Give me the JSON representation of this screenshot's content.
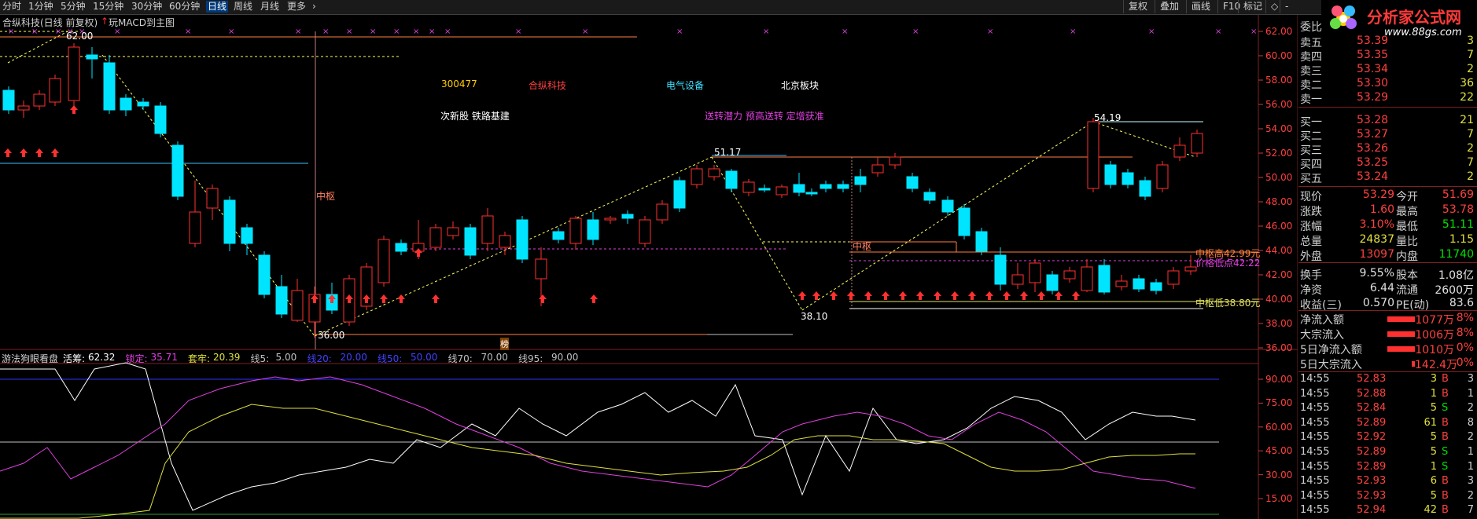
{
  "toolbar": {
    "tabs": [
      "分时",
      "1分钟",
      "5分钟",
      "15分钟",
      "30分钟",
      "60分钟",
      "日线",
      "周线",
      "月线",
      "更多",
      "›"
    ],
    "active_tab": "日线",
    "right_buttons": [
      "复权",
      "叠加",
      "画线",
      "F10",
      "标记",
      "◇",
      "-"
    ]
  },
  "logo": {
    "brand": "分析家公式网",
    "url": "www.88gs.com"
  },
  "chart_header": {
    "stock_title": "合纵科技(日线 前复权)",
    "macd_label": "玩MACD到主图"
  },
  "annotations": {
    "code": "300477",
    "name": "合纵科技",
    "industry": "电气设备",
    "region": "北京板块",
    "concepts": "次新股 铁路基建",
    "signals": "送转潜力 预高送转 定增获准",
    "zhongshu1": "中枢",
    "zhongshu2": "中枢",
    "high_label": "中枢高42.99元",
    "price_label": "价格低点42.22",
    "low_label": "中枢低38.80元",
    "p_top": "62.00",
    "p_5412": "54.19",
    "p_5117": "51.17",
    "p_3810": "38.10",
    "p_3600": "36.00",
    "bang": "榜"
  },
  "price_axis": [
    "62.00",
    "60.00",
    "58.00",
    "56.00",
    "54.00",
    "52.00",
    "50.00",
    "48.00",
    "46.00",
    "44.00",
    "42.00",
    "40.00",
    "38.00",
    "36.00"
  ],
  "indicator": {
    "name": "游法狗眼看盘",
    "items": [
      {
        "label": "活筹:",
        "value": "62.32",
        "color": "#ffffff"
      },
      {
        "label": "锁定:",
        "value": "35.71",
        "color": "#e040e0"
      },
      {
        "label": "套牢:",
        "value": "20.39",
        "color": "#e0e040"
      },
      {
        "label": "线5:",
        "value": "5.00",
        "color": "#c0c0c0"
      },
      {
        "label": "线20:",
        "value": "20.00",
        "color": "#4040ff"
      },
      {
        "label": "线50:",
        "value": "50.00",
        "color": "#4040ff"
      },
      {
        "label": "线70:",
        "value": "70.00",
        "color": "#c0c0c0"
      },
      {
        "label": "线95:",
        "value": "90.00",
        "color": "#c0c0c0"
      }
    ],
    "axis": [
      "90.00",
      "75.00",
      "60.00",
      "45.00",
      "30.00",
      "15.00"
    ]
  },
  "orderbook": {
    "header": "委比",
    "sell": [
      {
        "label": "卖五",
        "price": "53.39",
        "vol": "3"
      },
      {
        "label": "卖四",
        "price": "53.35",
        "vol": "7"
      },
      {
        "label": "卖三",
        "price": "53.34",
        "vol": "2"
      },
      {
        "label": "卖二",
        "price": "53.30",
        "vol": "36"
      },
      {
        "label": "卖一",
        "price": "53.29",
        "vol": "22"
      }
    ],
    "buy": [
      {
        "label": "买一",
        "price": "53.28",
        "vol": "21"
      },
      {
        "label": "买二",
        "price": "53.27",
        "vol": "7"
      },
      {
        "label": "买三",
        "price": "53.26",
        "vol": "2"
      },
      {
        "label": "买四",
        "price": "53.25",
        "vol": "7"
      },
      {
        "label": "买五",
        "price": "53.24",
        "vol": "2"
      }
    ]
  },
  "stats": [
    {
      "l1": "现价",
      "v1": "53.29",
      "c1": "#ff4040",
      "l2": "今开",
      "v2": "51.69",
      "c2": "#ff4040"
    },
    {
      "l1": "涨跌",
      "v1": "1.60",
      "c1": "#ff4040",
      "l2": "最高",
      "v2": "53.78",
      "c2": "#ff4040"
    },
    {
      "l1": "涨幅",
      "v1": "3.10%",
      "c1": "#ff4040",
      "l2": "最低",
      "v2": "51.11",
      "c2": "#00e000"
    },
    {
      "l1": "总量",
      "v1": "24837",
      "c1": "#e0e040",
      "l2": "量比",
      "v2": "1.15",
      "c2": "#e0e040"
    },
    {
      "l1": "外盘",
      "v1": "13097",
      "c1": "#ff4040",
      "l2": "内盘",
      "v2": "11740",
      "c2": "#00e000"
    },
    {
      "l1": "换手",
      "v1": "9.55%",
      "c1": "#e0e0e0",
      "l2": "股本",
      "v2": "1.08亿",
      "c2": "#e0e0e0"
    },
    {
      "l1": "净资",
      "v1": "6.44",
      "c1": "#e0e0e0",
      "l2": "流通",
      "v2": "2600万",
      "c2": "#e0e0e0"
    },
    {
      "l1": "收益(三)",
      "v1": "0.570",
      "c1": "#e0e0e0",
      "l2": "PE(动)",
      "v2": "83.6",
      "c2": "#e0e0e0"
    }
  ],
  "flows": [
    {
      "label": "净流入额",
      "value": "1077万",
      "pct": "8%",
      "bar": 0.8
    },
    {
      "label": "大宗流入",
      "value": "1006万",
      "pct": "8%",
      "bar": 0.8
    },
    {
      "label": "5日净流入额",
      "value": "1010万",
      "pct": "0%",
      "bar": 0.8
    },
    {
      "label": "5日大宗流入",
      "value": "142.4万",
      "pct": "0%",
      "bar": 0.1
    }
  ],
  "ticks": [
    {
      "time": "14:55",
      "price": "52.83",
      "vol": "3",
      "side": "B",
      "n": "3"
    },
    {
      "time": "14:55",
      "price": "52.88",
      "vol": "1",
      "side": "B",
      "n": "1"
    },
    {
      "time": "14:55",
      "price": "52.84",
      "vol": "5",
      "side": "S",
      "n": "2"
    },
    {
      "time": "14:55",
      "price": "52.89",
      "vol": "61",
      "side": "B",
      "n": "8"
    },
    {
      "time": "14:55",
      "price": "52.92",
      "vol": "5",
      "side": "B",
      "n": "2"
    },
    {
      "time": "14:55",
      "price": "52.89",
      "vol": "5",
      "side": "S",
      "n": "1"
    },
    {
      "time": "14:55",
      "price": "52.89",
      "vol": "1",
      "side": "S",
      "n": "1"
    },
    {
      "time": "14:55",
      "price": "52.93",
      "vol": "6",
      "side": "B",
      "n": "3"
    },
    {
      "time": "14:55",
      "price": "52.93",
      "vol": "5",
      "side": "B",
      "n": "2"
    },
    {
      "time": "14:55",
      "price": "52.94",
      "vol": "42",
      "side": "B",
      "n": "7"
    }
  ],
  "colors": {
    "up": "#ff3030",
    "down": "#00e5ff",
    "bg": "#000000",
    "grid": "#802020"
  }
}
